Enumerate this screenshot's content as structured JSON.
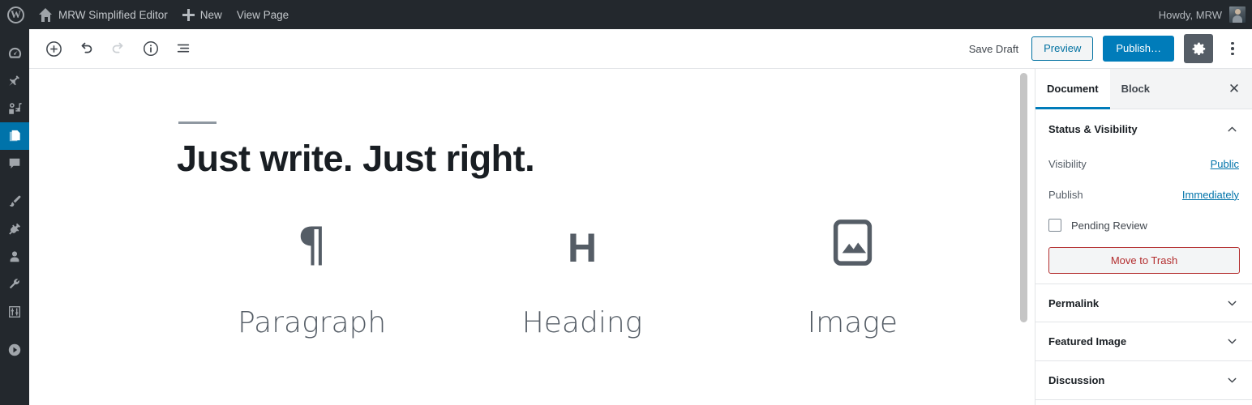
{
  "adminbar": {
    "wp_logo": "wordpress-logo",
    "site_name": "MRW Simplified Editor",
    "new_label": "New",
    "view_page_label": "View Page",
    "howdy": "Howdy, MRW"
  },
  "adminmenu": {
    "items": [
      {
        "name": "dashboard",
        "icon": "dashboard-icon",
        "current": false
      },
      {
        "name": "posts",
        "icon": "pin-icon",
        "current": false
      },
      {
        "name": "media",
        "icon": "media-icon",
        "current": false
      },
      {
        "name": "pages",
        "icon": "pages-icon",
        "current": true
      },
      {
        "name": "comments",
        "icon": "comment-icon",
        "current": false
      },
      {
        "name": "appearance",
        "icon": "brush-icon",
        "current": false
      },
      {
        "name": "plugins",
        "icon": "plug-icon",
        "current": false
      },
      {
        "name": "users",
        "icon": "user-icon",
        "current": false
      },
      {
        "name": "tools",
        "icon": "wrench-icon",
        "current": false
      },
      {
        "name": "settings",
        "icon": "sliders-icon",
        "current": false
      },
      {
        "name": "collapse-menu",
        "icon": "play-circle-icon",
        "current": false
      }
    ]
  },
  "header": {
    "add_block_icon": "plus-circle-icon",
    "undo_icon": "undo-icon",
    "redo_icon": "redo-icon",
    "info_icon": "info-circle-icon",
    "list_view_icon": "list-view-icon",
    "save_draft_label": "Save Draft",
    "preview_label": "Preview",
    "publish_label": "Publish…",
    "settings_gear_icon": "gear-icon",
    "more_menu_icon": "ellipsis-vertical-icon"
  },
  "canvas": {
    "post_title": "Just write. Just right.",
    "blocks": [
      {
        "label": "Paragraph",
        "glyph": "¶",
        "icon": "paragraph-icon"
      },
      {
        "label": "Heading",
        "glyph": "H",
        "icon": "heading-icon"
      },
      {
        "label": "Image",
        "glyph": "",
        "icon": "image-icon"
      }
    ]
  },
  "sidebar": {
    "tabs": [
      {
        "label": "Document",
        "active": true
      },
      {
        "label": "Block",
        "active": false
      }
    ],
    "close_icon": "close-icon",
    "status_panel": {
      "title": "Status & Visibility",
      "chevron": "chevron-up-icon",
      "visibility_key": "Visibility",
      "visibility_value": "Public",
      "publish_key": "Publish",
      "publish_value": "Immediately",
      "pending_review_label": "Pending Review",
      "pending_review_checked": false,
      "trash_label": "Move to Trash"
    },
    "panels": [
      {
        "title": "Permalink",
        "chevron": "chevron-down-icon"
      },
      {
        "title": "Featured Image",
        "chevron": "chevron-down-icon"
      },
      {
        "title": "Discussion",
        "chevron": "chevron-down-icon"
      }
    ]
  },
  "colors": {
    "wp_blue": "#007cba",
    "admin_dark": "#23282d",
    "menu_current": "#0073aa",
    "trash_red": "#b32d2e",
    "icon_gray": "#555d66"
  }
}
